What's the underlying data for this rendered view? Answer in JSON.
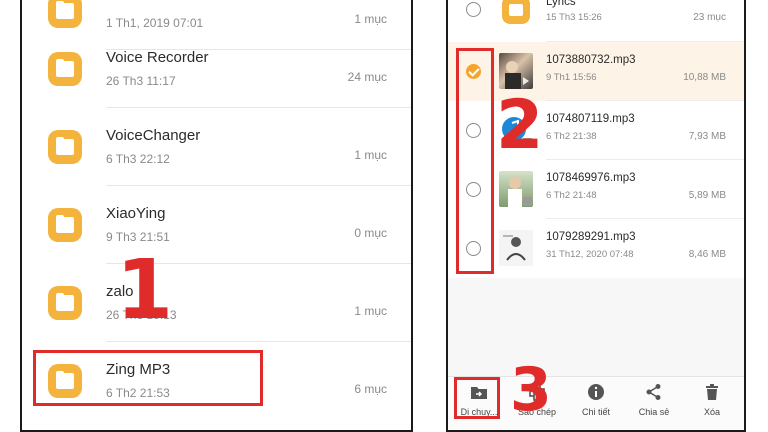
{
  "left_panel": {
    "folders": [
      {
        "name": "",
        "date": "1 Th1, 2019 07:01",
        "count": "1 mục"
      },
      {
        "name": "Voice Recorder",
        "date": "26 Th3 11:17",
        "count": "24 mục"
      },
      {
        "name": "VoiceChanger",
        "date": "6 Th3 22:12",
        "count": "1 mục"
      },
      {
        "name": "XiaoYing",
        "date": "9 Th3 21:51",
        "count": "0 mục"
      },
      {
        "name": "zalo",
        "date": "26 Th3 15:13",
        "count": "1 mục"
      },
      {
        "name": "Zing MP3",
        "date": "6 Th2 21:53",
        "count": "6 mục"
      }
    ]
  },
  "right_panel": {
    "folder_row": {
      "name": "Lyrics",
      "date": "15 Th3 15:26",
      "count": "23 mục"
    },
    "files": [
      {
        "name": "1073880732.mp3",
        "date": "9 Th1 15:56",
        "size": "10,88 MB",
        "checked": true
      },
      {
        "name": "1074807119.mp3",
        "date": "6 Th2 21:38",
        "size": "7,93 MB",
        "checked": false
      },
      {
        "name": "1078469976.mp3",
        "date": "6 Th2 21:48",
        "size": "5,89 MB",
        "checked": false
      },
      {
        "name": "1079289291.mp3",
        "date": "31 Th12, 2020 07:48",
        "size": "8,46 MB",
        "checked": false
      }
    ],
    "toolbar": {
      "move_label": "Di chuy...",
      "copy_label": "Sao chép",
      "details_label": "Chi tiết",
      "share_label": "Chia sẻ",
      "delete_label": "Xóa"
    }
  },
  "annotations": {
    "step1": "1",
    "step2": "2",
    "step3": "3"
  },
  "colors": {
    "accent": "#f3b33d",
    "highlight": "#e02b2b",
    "check": "#f4a52a"
  },
  "icons": {
    "folder": "folder-icon",
    "move": "folder-move-icon",
    "copy": "copy-icon",
    "details": "info-icon",
    "share": "share-icon",
    "delete": "trash-icon"
  }
}
